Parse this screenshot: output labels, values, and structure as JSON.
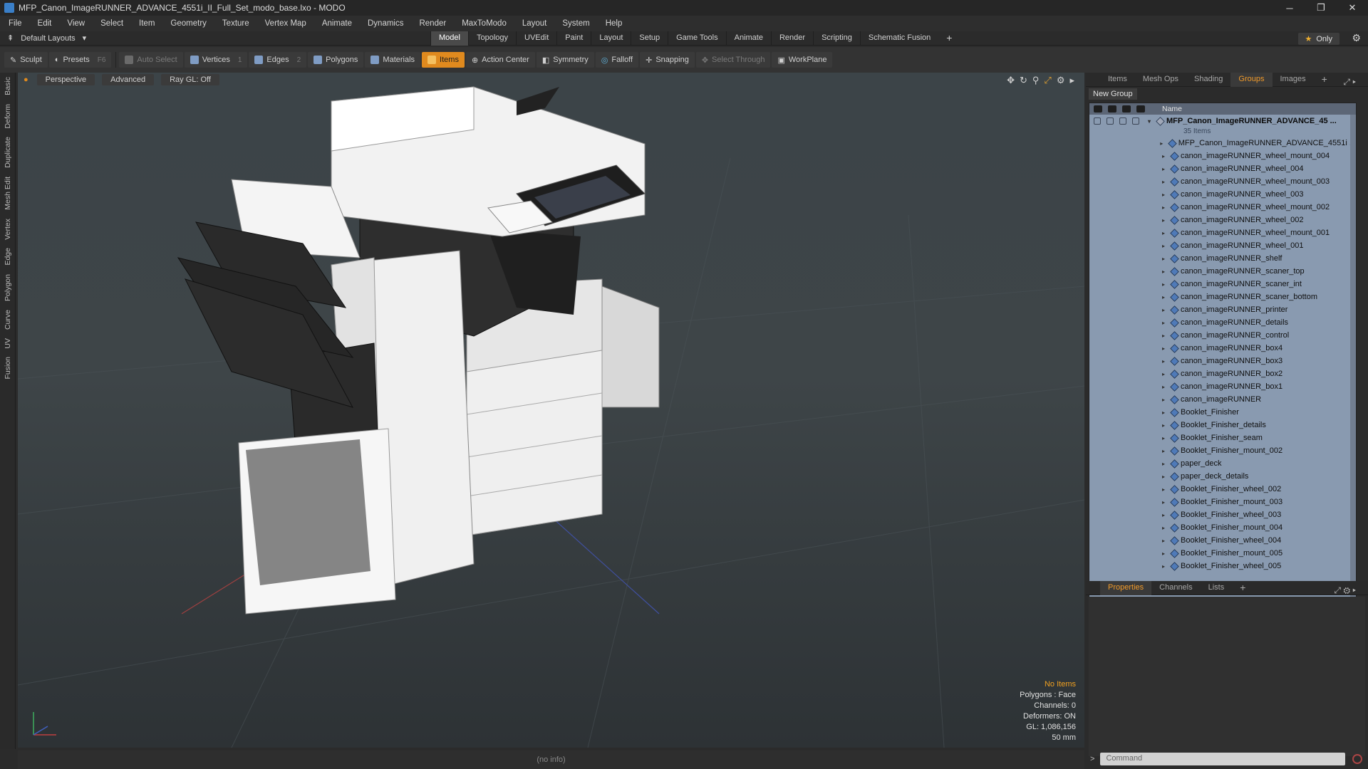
{
  "window": {
    "title": "MFP_Canon_ImageRUNNER_ADVANCE_4551i_II_Full_Set_modo_base.lxo - MODO",
    "controls": [
      "─",
      "❐",
      "✕"
    ]
  },
  "menu": [
    "File",
    "Edit",
    "View",
    "Select",
    "Item",
    "Geometry",
    "Texture",
    "Vertex Map",
    "Animate",
    "Dynamics",
    "Render",
    "MaxToModo",
    "Layout",
    "System",
    "Help"
  ],
  "layout": {
    "selector": "Default Layouts",
    "tabs": [
      "Model",
      "Topology",
      "UVEdit",
      "Paint",
      "Layout",
      "Setup",
      "Game Tools",
      "Animate",
      "Render",
      "Scripting",
      "Schematic Fusion"
    ],
    "active_tab": "Model",
    "only_label": "Only"
  },
  "toolbar": {
    "sculpt": "Sculpt",
    "presets": "Presets",
    "presets_key": "F6",
    "auto_select": "Auto Select",
    "vertices": "Vertices",
    "vertices_count": "1",
    "edges": "Edges",
    "edges_count": "2",
    "polygons": "Polygons",
    "materials": "Materials",
    "items": "Items",
    "action_center": "Action Center",
    "symmetry": "Symmetry",
    "falloff": "Falloff",
    "snapping": "Snapping",
    "select_through": "Select Through",
    "workplane": "WorkPlane"
  },
  "left_tabs": [
    "Basic",
    "Deform",
    "Duplicate",
    "Mesh Edit",
    "Vertex",
    "Edge",
    "Polygon",
    "Curve",
    "UV",
    "Fusion"
  ],
  "viewport": {
    "view": "Perspective",
    "mode": "Advanced",
    "raygl": "Ray GL: Off",
    "stats": {
      "selection": "No Items",
      "polygons": "Polygons : Face",
      "channels": "Channels: 0",
      "deformers": "Deformers: ON",
      "gl": "GL: 1,086,156",
      "scale": "50 mm"
    }
  },
  "status_bar": "(no info)",
  "right_panel": {
    "tabs": [
      "Items",
      "Mesh Ops",
      "Shading",
      "Groups",
      "Images"
    ],
    "active_tab": "Groups",
    "new_group": "New Group",
    "column_name": "Name",
    "root": {
      "name": "MFP_Canon_ImageRUNNER_ADVANCE_45 ...",
      "count": "35 Items"
    },
    "items": [
      "MFP_Canon_ImageRUNNER_ADVANCE_4551i ...",
      "canon_imageRUNNER_wheel_mount_004",
      "canon_imageRUNNER_wheel_004",
      "canon_imageRUNNER_wheel_mount_003",
      "canon_imageRUNNER_wheel_003",
      "canon_imageRUNNER_wheel_mount_002",
      "canon_imageRUNNER_wheel_002",
      "canon_imageRUNNER_wheel_mount_001",
      "canon_imageRUNNER_wheel_001",
      "canon_imageRUNNER_shelf",
      "canon_imageRUNNER_scaner_top",
      "canon_imageRUNNER_scaner_int",
      "canon_imageRUNNER_scaner_bottom",
      "canon_imageRUNNER_printer",
      "canon_imageRUNNER_details",
      "canon_imageRUNNER_control",
      "canon_imageRUNNER_box4",
      "canon_imageRUNNER_box3",
      "canon_imageRUNNER_box2",
      "canon_imageRUNNER_box1",
      "canon_imageRUNNER",
      "Booklet_Finisher",
      "Booklet_Finisher_details",
      "Booklet_Finisher_seam",
      "Booklet_Finisher_mount_002",
      "paper_deck",
      "paper_deck_details",
      "Booklet_Finisher_wheel_002",
      "Booklet_Finisher_mount_003",
      "Booklet_Finisher_wheel_003",
      "Booklet_Finisher_mount_004",
      "Booklet_Finisher_wheel_004",
      "Booklet_Finisher_mount_005",
      "Booklet_Finisher_wheel_005"
    ],
    "bottom_tabs": [
      "Properties",
      "Channels",
      "Lists"
    ],
    "bottom_active": "Properties",
    "command_placeholder": "Command"
  }
}
